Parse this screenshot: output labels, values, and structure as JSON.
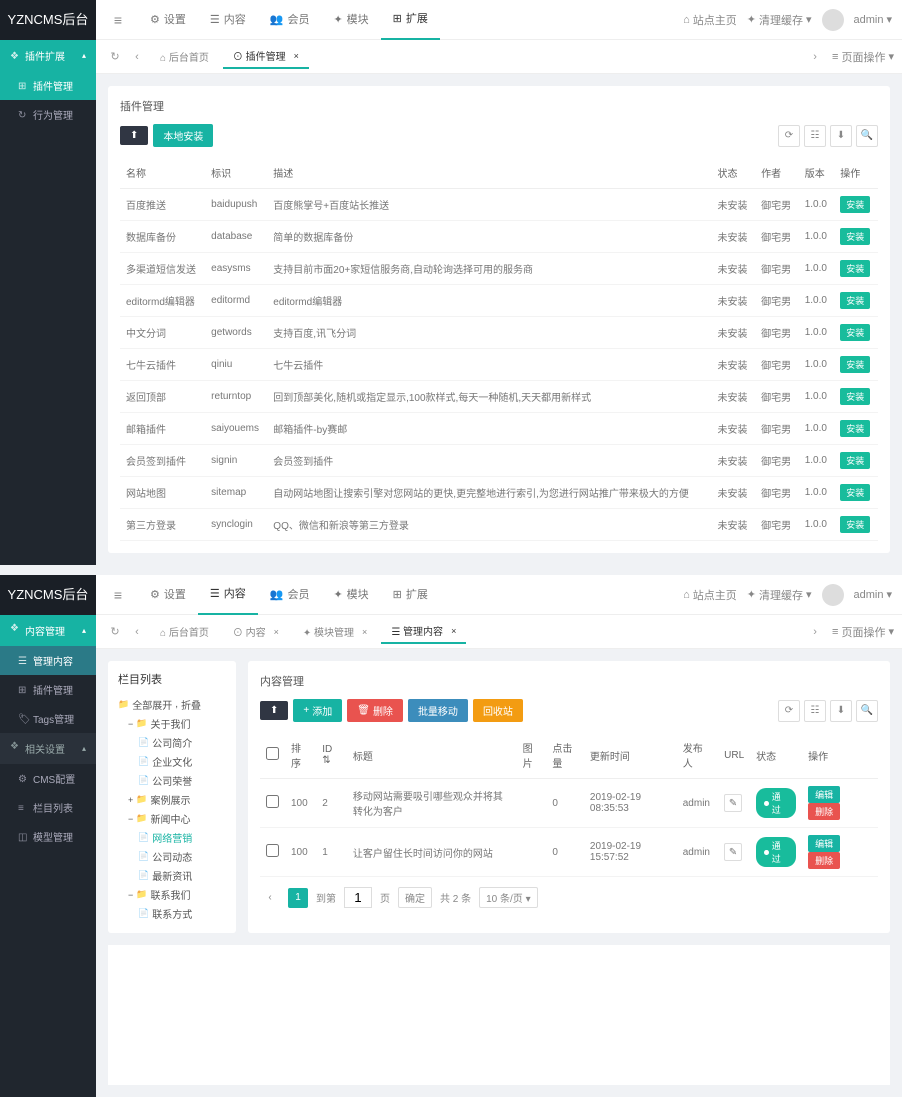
{
  "logo": "YZNCMS后台",
  "top_nav": [
    {
      "icon": "⚙",
      "label": "设置"
    },
    {
      "icon": "☰",
      "label": "内容"
    },
    {
      "icon": "👥",
      "label": "会员"
    },
    {
      "icon": "✦",
      "label": "模块"
    },
    {
      "icon": "⊞",
      "label": "扩展"
    }
  ],
  "top_right": {
    "site_home": "站点主页",
    "clear_cache": "清理缓存",
    "user": "admin"
  },
  "subtabs1": [
    {
      "label": "后台首页",
      "icon": "⌂"
    },
    {
      "label": "插件管理",
      "icon": "⊙"
    }
  ],
  "subtabs2": [
    {
      "label": "后台首页",
      "icon": "⌂"
    },
    {
      "label": "内容",
      "icon": "⊙"
    },
    {
      "label": "模块管理",
      "icon": "✦"
    },
    {
      "label": "管理内容",
      "icon": "☰"
    }
  ],
  "page_ops": "页面操作",
  "upper": {
    "sidebar": {
      "group": "插件扩展",
      "items": [
        {
          "icon": "⊞",
          "label": "插件管理",
          "active": true
        },
        {
          "icon": "↻",
          "label": "行为管理"
        }
      ]
    },
    "title": "插件管理",
    "btn_local": "本地安装",
    "columns": [
      "名称",
      "标识",
      "描述",
      "状态",
      "作者",
      "版本",
      "操作"
    ],
    "action_install": "安装",
    "rows": [
      {
        "name": "百度推送",
        "key": "baidupush",
        "desc": "百度熊掌号+百度站长推送",
        "status": "未安装",
        "author": "御宅男",
        "ver": "1.0.0"
      },
      {
        "name": "数据库备份",
        "key": "database",
        "desc": "简单的数据库备份",
        "status": "未安装",
        "author": "御宅男",
        "ver": "1.0.0"
      },
      {
        "name": "多渠道短信发送",
        "key": "easysms",
        "desc": "支持目前市面20+家短信服务商,自动轮询选择可用的服务商",
        "status": "未安装",
        "author": "御宅男",
        "ver": "1.0.0"
      },
      {
        "name": "editormd编辑器",
        "key": "editormd",
        "desc": "editormd编辑器",
        "status": "未安装",
        "author": "御宅男",
        "ver": "1.0.0"
      },
      {
        "name": "中文分词",
        "key": "getwords",
        "desc": "支持百度,讯飞分词",
        "status": "未安装",
        "author": "御宅男",
        "ver": "1.0.0"
      },
      {
        "name": "七牛云插件",
        "key": "qiniu",
        "desc": "七牛云插件",
        "status": "未安装",
        "author": "御宅男",
        "ver": "1.0.0"
      },
      {
        "name": "返回顶部",
        "key": "returntop",
        "desc": "回到顶部美化,随机或指定显示,100款样式,每天一种随机,天天都用新样式",
        "status": "未安装",
        "author": "御宅男",
        "ver": "1.0.0"
      },
      {
        "name": "邮箱插件",
        "key": "saiyouems",
        "desc": "邮箱插件-by赛邮",
        "status": "未安装",
        "author": "御宅男",
        "ver": "1.0.0"
      },
      {
        "name": "会员签到插件",
        "key": "signin",
        "desc": "会员签到插件",
        "status": "未安装",
        "author": "御宅男",
        "ver": "1.0.0"
      },
      {
        "name": "网站地图",
        "key": "sitemap",
        "desc": "自动网站地图让搜索引擎对您网站的更快,更完整地进行索引,为您进行网站推广带来极大的方便",
        "status": "未安装",
        "author": "御宅男",
        "ver": "1.0.0"
      },
      {
        "name": "第三方登录",
        "key": "synclogin",
        "desc": "QQ、微信和新浪等第三方登录",
        "status": "未安装",
        "author": "御宅男",
        "ver": "1.0.0"
      }
    ]
  },
  "lower": {
    "sidebar": {
      "groups": [
        {
          "label": "内容管理",
          "items": [
            {
              "icon": "☰",
              "label": "管理内容",
              "active": true
            },
            {
              "icon": "⊞",
              "label": "插件管理"
            },
            {
              "icon": "🏷",
              "label": "Tags管理"
            }
          ]
        },
        {
          "label": "相关设置",
          "items": [
            {
              "icon": "⚙",
              "label": "CMS配置"
            },
            {
              "icon": "≡",
              "label": "栏目列表"
            },
            {
              "icon": "◫",
              "label": "模型管理"
            }
          ]
        }
      ]
    },
    "tree_title": "栏目列表",
    "tree_expand": "全部展开",
    "tree_collapse": "折叠",
    "tree": [
      {
        "label": "关于我们",
        "lvl": 1,
        "exp": "−"
      },
      {
        "label": "公司简介",
        "lvl": 2,
        "doc": true
      },
      {
        "label": "企业文化",
        "lvl": 2,
        "doc": true
      },
      {
        "label": "公司荣誉",
        "lvl": 2,
        "doc": true
      },
      {
        "label": "案例展示",
        "lvl": 1,
        "exp": "+"
      },
      {
        "label": "新闻中心",
        "lvl": 1,
        "exp": "−"
      },
      {
        "label": "网络营销",
        "lvl": 2,
        "doc": true,
        "sel": true
      },
      {
        "label": "公司动态",
        "lvl": 2,
        "doc": true
      },
      {
        "label": "最新资讯",
        "lvl": 2,
        "doc": true
      },
      {
        "label": "联系我们",
        "lvl": 1,
        "exp": "−"
      },
      {
        "label": "联系方式",
        "lvl": 2,
        "doc": true
      }
    ],
    "content_title": "内容管理",
    "btns": {
      "add": "添加",
      "del": "删除",
      "move": "批量移动",
      "recycle": "回收站"
    },
    "columns": [
      "",
      "排序",
      "ID",
      "标题",
      "图片",
      "点击量",
      "更新时间",
      "发布人",
      "URL",
      "状态",
      "操作"
    ],
    "status_pass": "通过",
    "act_edit": "编辑",
    "act_del": "删除",
    "rows": [
      {
        "sort": "100",
        "id": "2",
        "title": "移动网站需要吸引哪些观众并将其转化为客户",
        "hits": "0",
        "time": "2019-02-19 08:35:53",
        "user": "admin"
      },
      {
        "sort": "100",
        "id": "1",
        "title": "让客户留住长时间访问你的网站",
        "hits": "0",
        "time": "2019-02-19 15:57:52",
        "user": "admin"
      }
    ],
    "pagination": {
      "to_page": "到第",
      "page_unit": "页",
      "confirm": "确定",
      "total": "共 2 条",
      "per_page": "10 条/页"
    }
  }
}
